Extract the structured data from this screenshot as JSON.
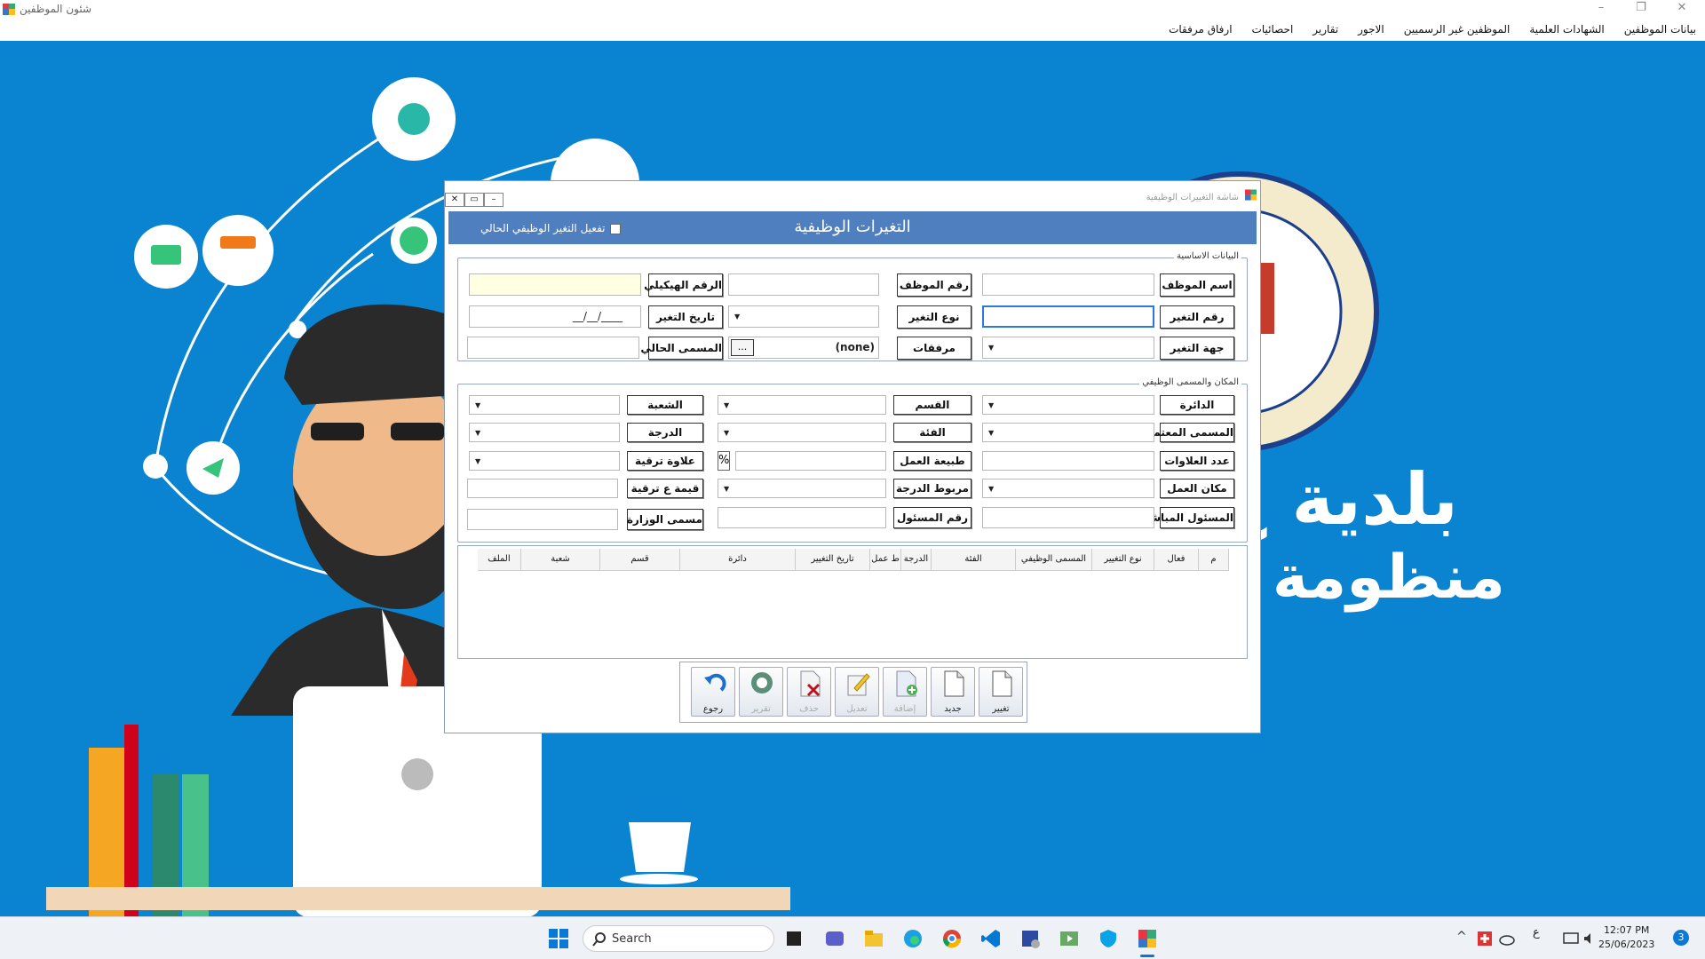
{
  "window": {
    "title": "شئون الموظفين"
  },
  "menu": [
    "بيانات الموظفين",
    "الشهادات العلمية",
    "الموظفين غير الرسميين",
    "الاجور",
    "تقارير",
    "احصائيات",
    "ارفاق مرفقات"
  ],
  "background": {
    "line1": "بلدية ج",
    "line2": "منظومة ش"
  },
  "dialog": {
    "title": "شاشة التغييرات الوظيفية",
    "header": "التغيرات الوظيفية",
    "activate_label": "تفعيل التغير الوظيفي الحالي",
    "basic_group": "البيانات الاساسية",
    "place_group": "المكان والمسمى الوظيفي",
    "labels": {
      "employee_name": "اسم الموظف",
      "employee_no": "رقم الموظف",
      "structural_no": "الرقم الهيكيلي",
      "change_no": "رقم التغير",
      "change_type": "نوع التغير",
      "change_date": "تاريخ التغير",
      "change_party": "جهة التغير",
      "attachments": "مرفقات",
      "current_title": "المسمى الحالي",
      "circle": "الدائرة",
      "department": "القسم",
      "division": "الشعبة",
      "approved_title": "المسمى المعتمد",
      "category": "الفئة",
      "grade": "الدرجة",
      "allowances_count": "عدد العلاوات",
      "work_nature": "طبيعة العمل",
      "promotion_allowance": "علاوة ترقية",
      "workplace": "مكان العمل",
      "grade_link": "مربوط الدرجة",
      "promotion_value": "قيمة ع ترقية",
      "direct_manager": "المسئول المباشر",
      "manager_no": "رقم المسئول",
      "ministry_title": "مسمى الوزارة"
    },
    "values": {
      "change_date": "__/__/____",
      "attachments": "(none)",
      "browse": "...",
      "percent": "%"
    },
    "grid_columns": [
      "م",
      "فعال",
      "نوع التغيير",
      "المسمى الوظيفي",
      "الفئة",
      "الدرجة",
      "ط عمل",
      "تاريخ التغيير",
      "دائرة",
      "قسم",
      "شعبة",
      "الملف"
    ],
    "buttons": {
      "change": "تغيير",
      "new": "جديد",
      "add": "إضافة",
      "edit": "تعديل",
      "delete": "حذف",
      "report": "تقرير",
      "back": "رجوع"
    }
  },
  "taskbar": {
    "search": "Search",
    "time": "12:07 PM",
    "date": "25/06/2023",
    "lang": "ع",
    "notifications": "3"
  }
}
